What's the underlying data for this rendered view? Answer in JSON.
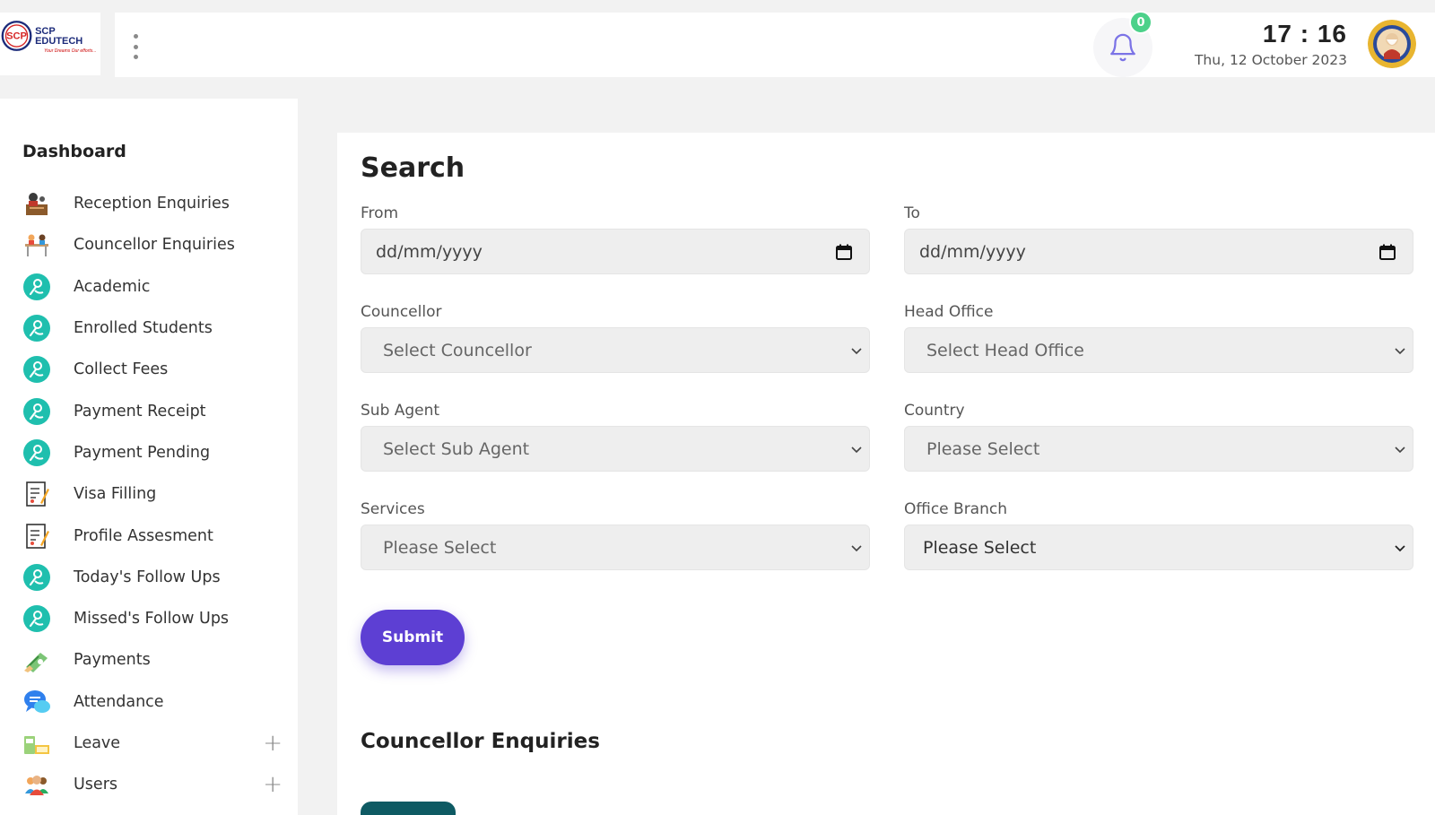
{
  "brand": {
    "name": "SCP EDUTECH",
    "tagline": "Your Dreams Our efforts..."
  },
  "header": {
    "notification_count": "0",
    "time": "17 : 16",
    "date": "Thu, 12 October 2023"
  },
  "sidebar": {
    "dashboard_label": "Dashboard",
    "items": [
      {
        "label": "Reception Enquiries",
        "icon": "reception-icon"
      },
      {
        "label": "Councellor Enquiries",
        "icon": "councellor-icon"
      },
      {
        "label": "Academic",
        "icon": "teal-person-icon"
      },
      {
        "label": "Enrolled Students",
        "icon": "teal-person-icon"
      },
      {
        "label": "Collect Fees",
        "icon": "teal-person-icon"
      },
      {
        "label": "Payment Receipt",
        "icon": "teal-person-icon"
      },
      {
        "label": "Payment Pending",
        "icon": "teal-person-icon"
      },
      {
        "label": "Visa Filling",
        "icon": "document-icon"
      },
      {
        "label": "Profile Assesment",
        "icon": "document-icon"
      },
      {
        "label": "Today's Follow Ups",
        "icon": "teal-person-icon"
      },
      {
        "label": "Missed's Follow Ups",
        "icon": "teal-person-icon"
      },
      {
        "label": "Payments",
        "icon": "payment-icon"
      },
      {
        "label": "Attendance",
        "icon": "chat-icon"
      },
      {
        "label": "Leave",
        "icon": "leave-icon",
        "expandable": true
      },
      {
        "label": "Users",
        "icon": "users-icon",
        "expandable": true
      }
    ],
    "expand_symbol": "+"
  },
  "search": {
    "title": "Search",
    "from_label": "From",
    "from_placeholder": "dd/mm/yyyy",
    "to_label": "To",
    "to_placeholder": "dd/mm/yyyy",
    "councellor_label": "Councellor",
    "councellor_value": "Select Councellor",
    "head_office_label": "Head Office",
    "head_office_value": "Select Head Office",
    "sub_agent_label": "Sub Agent",
    "sub_agent_value": "Select Sub Agent",
    "country_label": "Country",
    "country_value": "Please Select",
    "services_label": "Services",
    "services_value": "Please Select",
    "office_branch_label": "Office Branch",
    "office_branch_value": "Please Select",
    "submit_label": "Submit"
  },
  "enquiries": {
    "title": "Councellor Enquiries"
  },
  "colors": {
    "accent": "#5d3fd3",
    "badge": "#4cd18a",
    "teal": "#0e5a63",
    "bell": "#7b73e6"
  }
}
